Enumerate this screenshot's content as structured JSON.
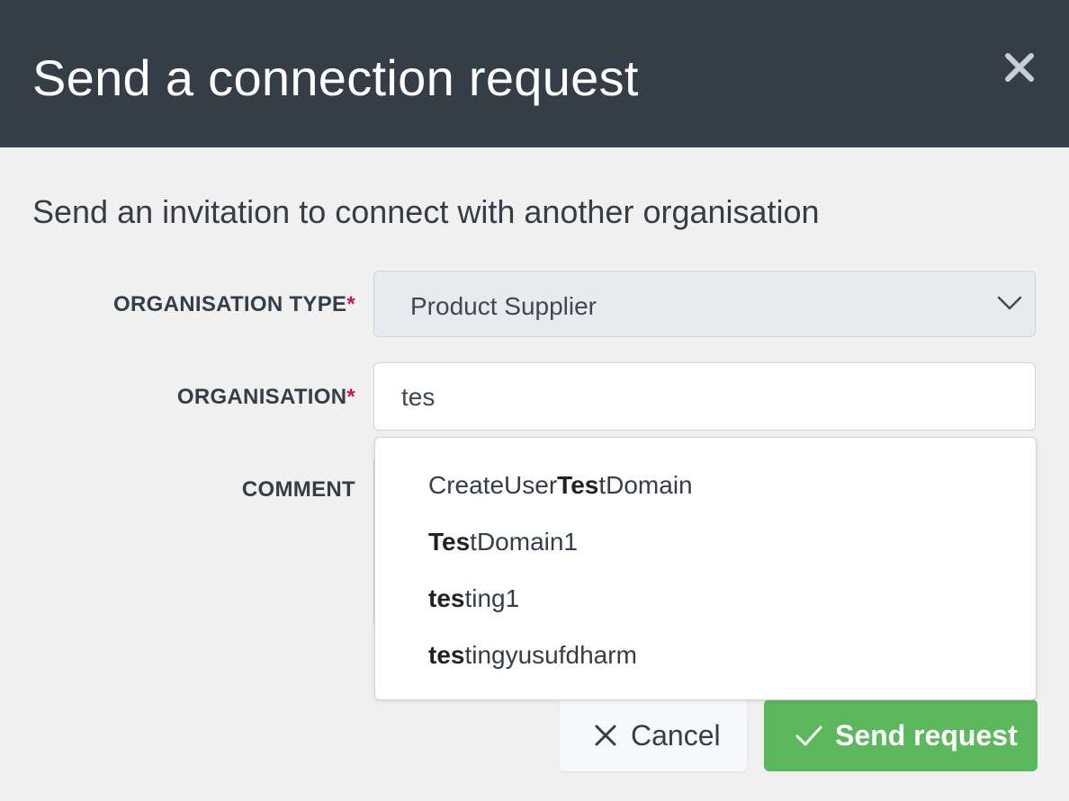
{
  "modal": {
    "title": "Send a connection request",
    "close_icon": "close-icon",
    "subtitle": "Send an invitation to connect with another organisation"
  },
  "form": {
    "organisation_type": {
      "label": "ORGANISATION TYPE",
      "required_marker": "*",
      "selected_value": "Product Supplier",
      "icon": "chevron-down-icon"
    },
    "organisation": {
      "label": "ORGANISATION",
      "required_marker": "*",
      "value": "tes"
    },
    "comment": {
      "label": "COMMENT",
      "value": ""
    }
  },
  "autocomplete": {
    "items": [
      {
        "prefix": "CreateUser",
        "match": "Tes",
        "suffix": "tDomain"
      },
      {
        "prefix": "",
        "match": "Tes",
        "suffix": "tDomain1"
      },
      {
        "prefix": "",
        "match": "tes",
        "suffix": "ting1"
      },
      {
        "prefix": "",
        "match": "tes",
        "suffix": "tingyusufdharm"
      }
    ]
  },
  "actions": {
    "cancel_label": "Cancel",
    "cancel_icon": "close-icon",
    "send_label": "Send request",
    "send_icon": "check-icon"
  },
  "colors": {
    "header_bg": "#353d47",
    "body_bg": "#f0f0f0",
    "required": "#d0124f",
    "send_button": "#5cb85c"
  }
}
